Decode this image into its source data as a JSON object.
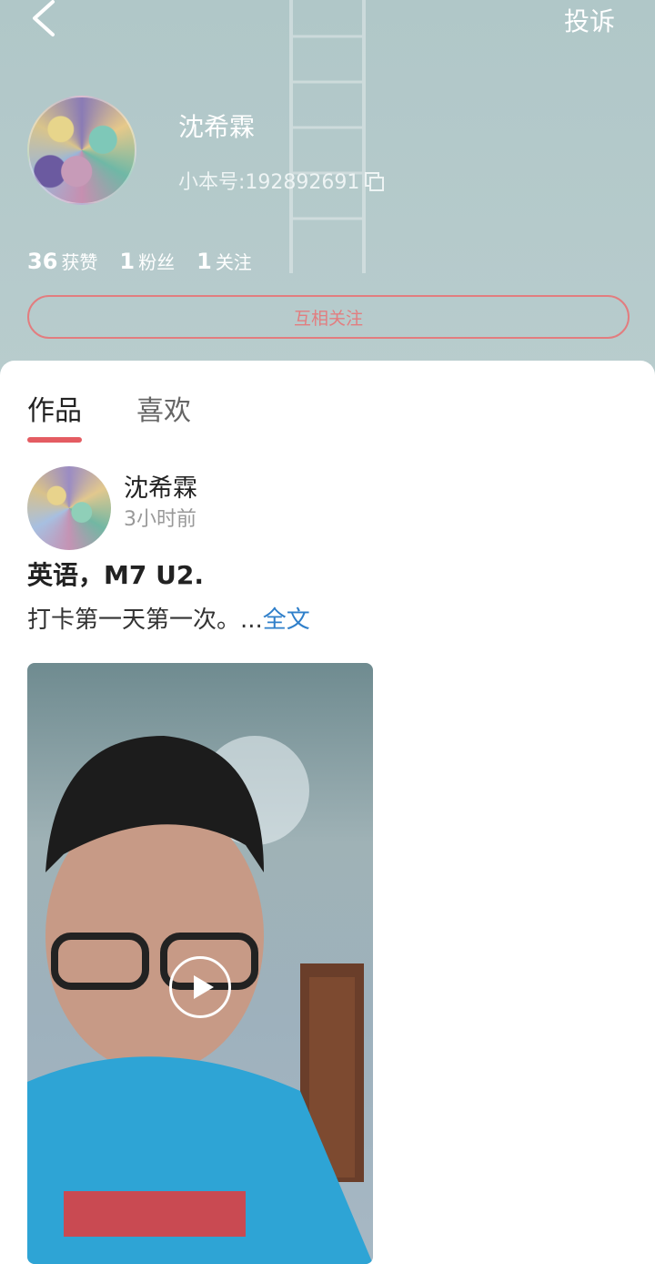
{
  "header": {
    "report_label": "投诉",
    "name": "沈希霖",
    "id_text": "小本号:192892691",
    "stats": [
      {
        "num": "36",
        "label": "获赞"
      },
      {
        "num": "1",
        "label": "粉丝"
      },
      {
        "num": "1",
        "label": "关注"
      }
    ],
    "follow_label": "互相关注"
  },
  "tabs": [
    {
      "label": "作品",
      "active": true
    },
    {
      "label": "喜欢",
      "active": false
    }
  ],
  "post": {
    "author": "沈希霖",
    "time": "3小时前",
    "title": "英语，M7 U2.",
    "text": "打卡第一天第一次。...",
    "more_label": "全文"
  },
  "colors": {
    "accent": "#e45c62",
    "link": "#2f7fca",
    "header_bg": "#b3c9ca"
  }
}
